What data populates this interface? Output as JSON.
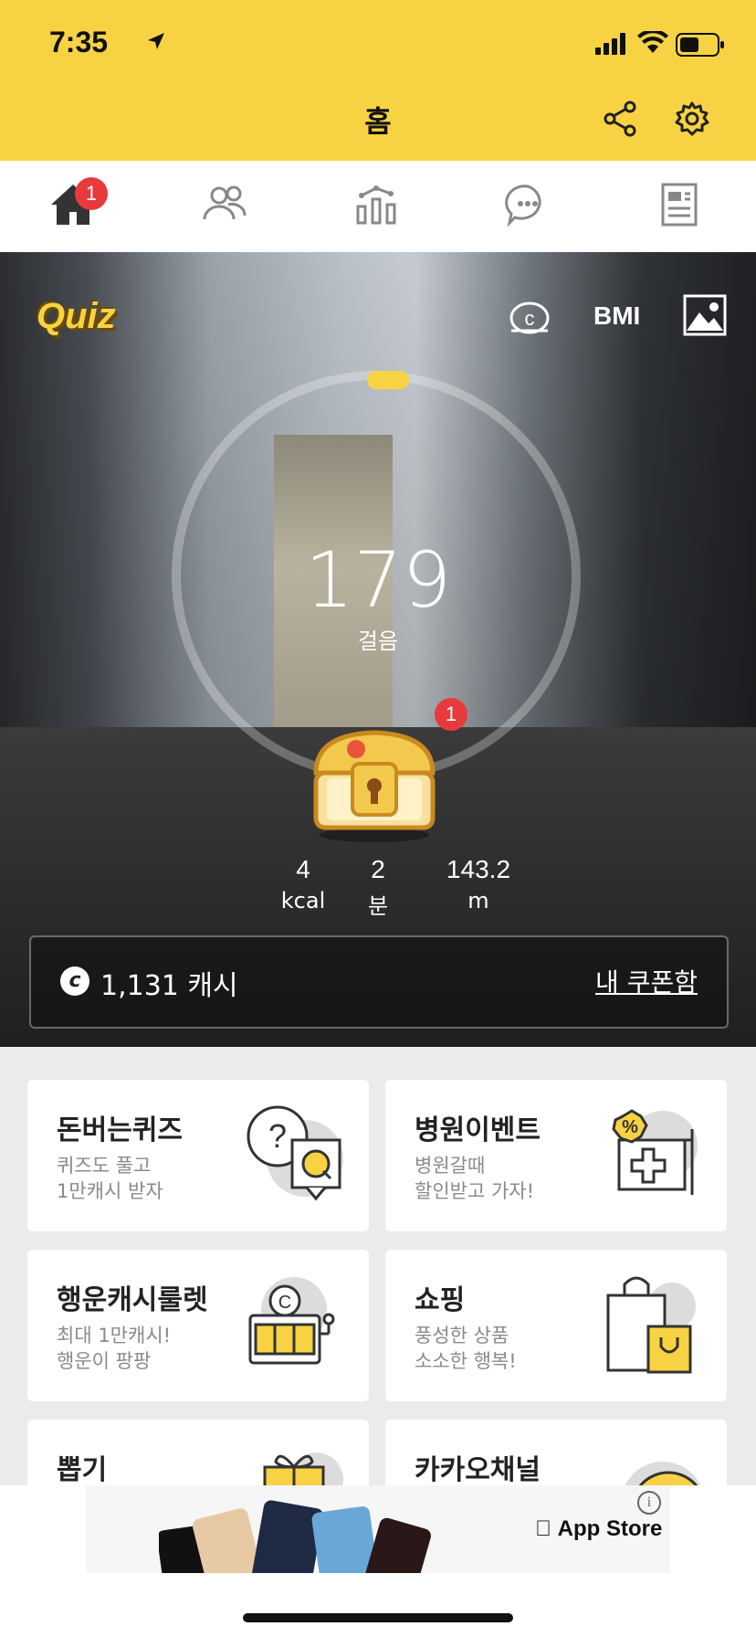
{
  "status_bar": {
    "time": "7:35"
  },
  "header": {
    "title": "홈"
  },
  "tabs": {
    "home_badge": "1"
  },
  "hero": {
    "quiz_logo": "Quiz",
    "bmi_label": "BMI",
    "steps": "179",
    "steps_label": "걸음",
    "chest_badge": "1",
    "step_goal_progress": 0.0,
    "stats": [
      {
        "value": "4",
        "unit": "kcal"
      },
      {
        "value": "2",
        "unit": "분"
      },
      {
        "value": "143.2",
        "unit": "m"
      }
    ],
    "cash_icon": "c",
    "cash_text": "1,131 캐시",
    "coupon_link": "내 쿠폰함"
  },
  "cards": [
    {
      "title": "돈버는퀴즈",
      "sub": "퀴즈도 풀고\n1만캐시 받자",
      "icon": "quiz-icon"
    },
    {
      "title": "병원이벤트",
      "sub": "병원갈때\n할인받고 가자!",
      "icon": "hospital-icon"
    },
    {
      "title": "행운캐시룰렛",
      "sub": "최대 1만캐시!\n행운이 팡팡",
      "icon": "slot-machine-icon"
    },
    {
      "title": "쇼핑",
      "sub": "풍성한 상품\n소소한 행복!",
      "icon": "shopping-bag-icon"
    },
    {
      "title": "뽑기",
      "sub": "",
      "icon": "gift-icon"
    },
    {
      "title": "카카오채널",
      "sub": "",
      "icon": "kakao-channel-icon"
    }
  ],
  "ad": {
    "store_label": "App Store",
    "info": "i"
  },
  "colors": {
    "brand_yellow": "#f7d343",
    "badge_red": "#e8393c"
  }
}
